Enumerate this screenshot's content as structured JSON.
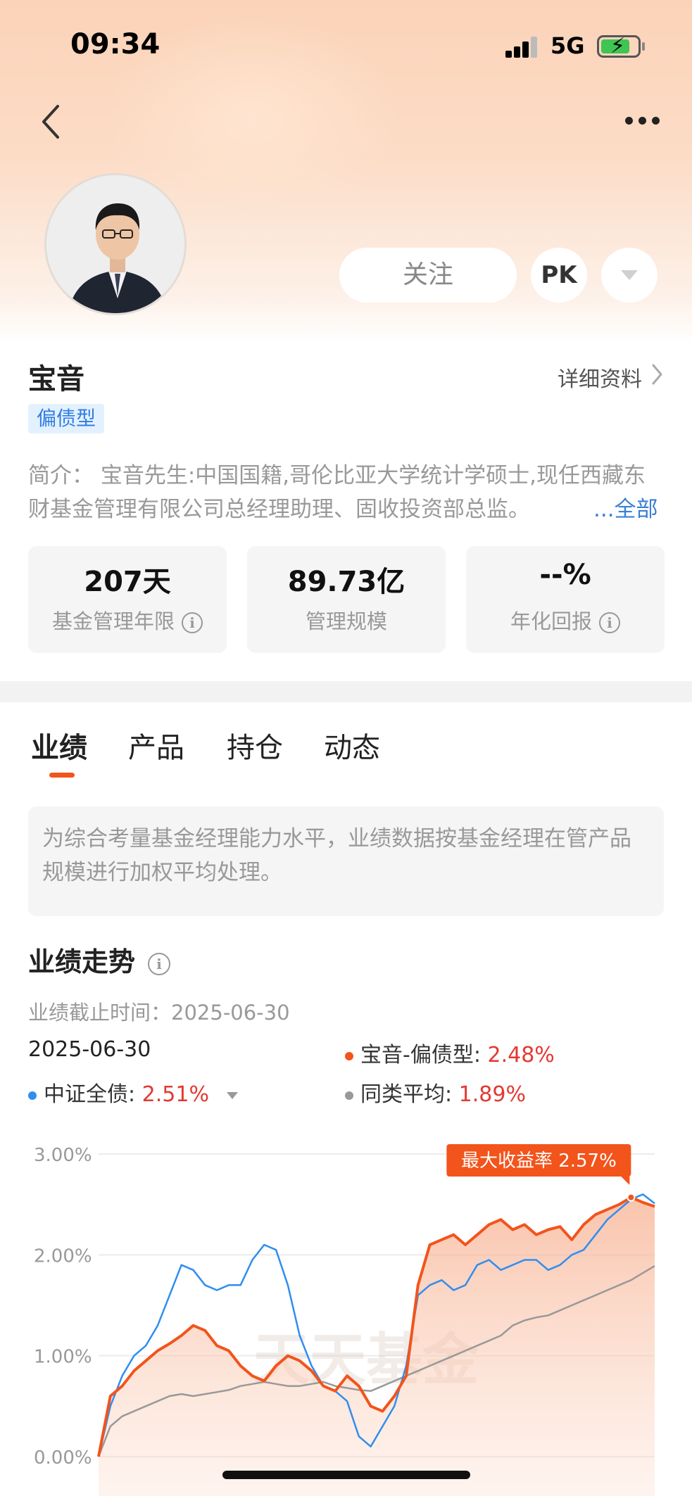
{
  "status_bar": {
    "time": "09:34",
    "network": "5G"
  },
  "profile": {
    "follow_label": "关注",
    "pk_label": "PK",
    "name": "宝音",
    "detail_link": "详细资料",
    "type_tag": "偏债型",
    "intro": "简介：  宝音先生:中国国籍,哥伦比亚大学统计学硕士,现任西藏东财基金管理有限公司总经理助理、固收投资部总监。",
    "intro_more": "...全部"
  },
  "stats": [
    {
      "value": "207天",
      "label": "基金管理年限"
    },
    {
      "value": "89.73亿",
      "label": "管理规模"
    },
    {
      "value": "--%",
      "label": "年化回报"
    }
  ],
  "tabs": [
    "业绩",
    "产品",
    "持仓",
    "动态"
  ],
  "active_tab": "业绩",
  "notice": "为综合考量基金经理能力水平，业绩数据按基金经理在管产品规模进行加权平均处理。",
  "performance": {
    "title": "业绩走势",
    "cutoff_label": "业绩截止时间：",
    "cutoff_date": "2025-06-30",
    "legend_date": "2025-06-30",
    "legend": [
      {
        "name": "宝音-偏债型",
        "value": "2.48%",
        "color": "#f2541b"
      },
      {
        "name": "中证全债",
        "value": "2.51%",
        "color": "#2f8ef0"
      },
      {
        "name": "同类平均",
        "value": "1.89%",
        "color": "#999999"
      }
    ]
  },
  "chart_data": {
    "type": "line",
    "yticks": [
      "3.00%",
      "2.00%",
      "1.00%",
      "0.00%"
    ],
    "ylim": [
      0,
      3
    ],
    "max_label": "最大收益率 2.57%",
    "watermark": "天天基金",
    "series": [
      {
        "name": "宝音-偏债型",
        "color": "#f2541b",
        "values": [
          0.0,
          0.6,
          0.7,
          0.85,
          0.95,
          1.05,
          1.12,
          1.2,
          1.3,
          1.25,
          1.1,
          1.05,
          0.9,
          0.8,
          0.75,
          0.9,
          1.0,
          0.95,
          0.85,
          0.7,
          0.65,
          0.8,
          0.7,
          0.5,
          0.45,
          0.6,
          0.8,
          1.7,
          2.1,
          2.15,
          2.2,
          2.1,
          2.2,
          2.3,
          2.35,
          2.25,
          2.3,
          2.2,
          2.25,
          2.28,
          2.15,
          2.3,
          2.4,
          2.45,
          2.5,
          2.57,
          2.52,
          2.48
        ]
      },
      {
        "name": "中证全债",
        "color": "#2f8ef0",
        "values": [
          0.0,
          0.5,
          0.8,
          1.0,
          1.1,
          1.3,
          1.6,
          1.9,
          1.85,
          1.7,
          1.65,
          1.7,
          1.7,
          1.95,
          2.1,
          2.05,
          1.7,
          1.2,
          0.9,
          0.7,
          0.65,
          0.55,
          0.2,
          0.1,
          0.3,
          0.5,
          0.9,
          1.6,
          1.7,
          1.75,
          1.65,
          1.7,
          1.9,
          1.95,
          1.85,
          1.9,
          1.95,
          1.95,
          1.85,
          1.9,
          2.0,
          2.05,
          2.2,
          2.35,
          2.45,
          2.55,
          2.6,
          2.51
        ]
      },
      {
        "name": "同类平均",
        "color": "#999999",
        "values": [
          0.0,
          0.3,
          0.4,
          0.45,
          0.5,
          0.55,
          0.6,
          0.62,
          0.6,
          0.62,
          0.64,
          0.66,
          0.7,
          0.72,
          0.74,
          0.72,
          0.7,
          0.7,
          0.72,
          0.74,
          0.7,
          0.68,
          0.66,
          0.65,
          0.7,
          0.75,
          0.8,
          0.85,
          0.9,
          0.95,
          1.0,
          1.05,
          1.1,
          1.15,
          1.2,
          1.3,
          1.35,
          1.38,
          1.4,
          1.45,
          1.5,
          1.55,
          1.6,
          1.65,
          1.7,
          1.75,
          1.82,
          1.89
        ]
      }
    ]
  }
}
